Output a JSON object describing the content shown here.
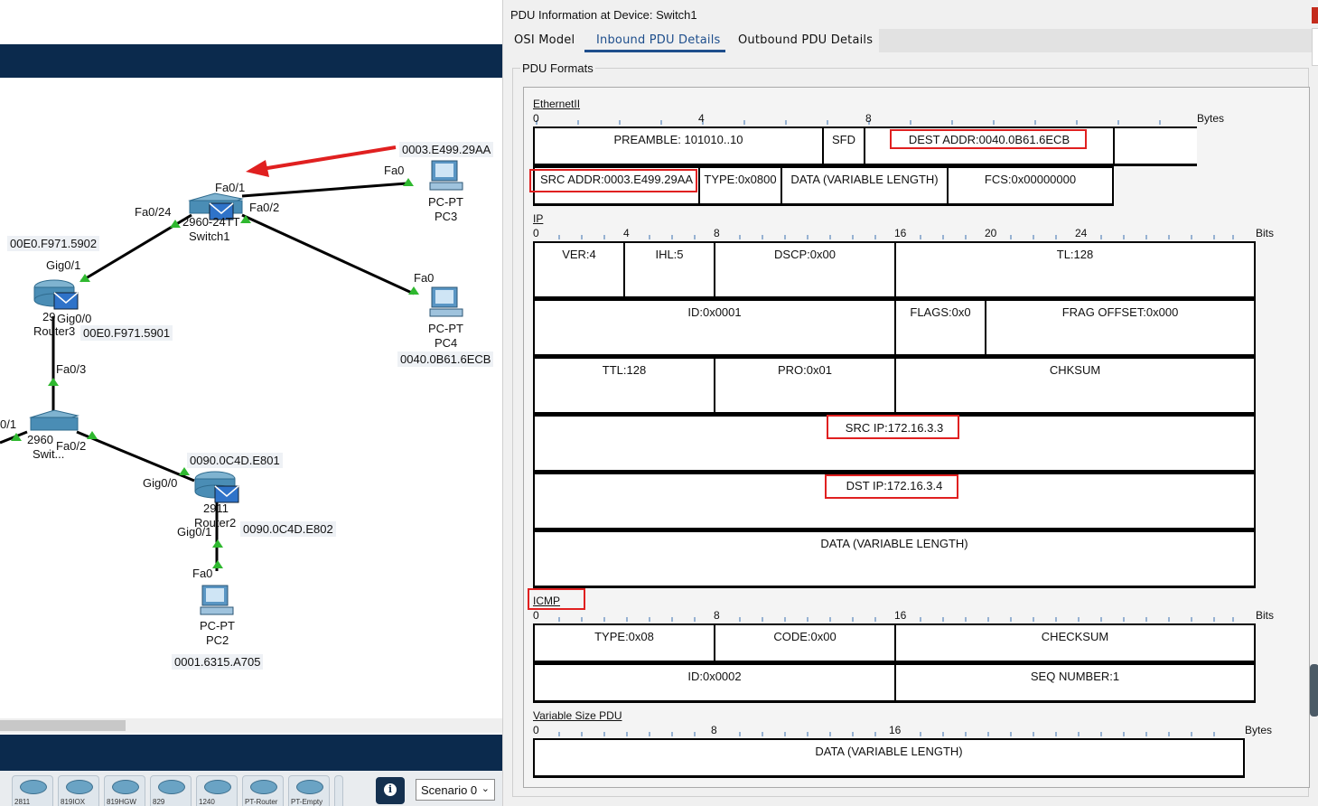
{
  "dialog": {
    "title": "PDU Information at Device: Switch1",
    "tabs": [
      "OSI Model",
      "Inbound PDU Details",
      "Outbound PDU Details"
    ],
    "active_tab": "Inbound PDU Details",
    "group_label": "PDU Formats"
  },
  "ethernet": {
    "name": "EthernetII",
    "unit": "Bytes",
    "ticks": [
      "0",
      "4",
      "8"
    ],
    "fields": {
      "preamble": "PREAMBLE: 101010..10",
      "sfd": "SFD",
      "dest": "DEST ADDR:0040.0B61.6ECB",
      "src": "SRC ADDR:0003.E499.29AA",
      "type": "TYPE:0x0800",
      "data": "DATA (VARIABLE LENGTH)",
      "fcs": "FCS:0x00000000"
    }
  },
  "ip": {
    "name": "IP",
    "unit": "Bits",
    "ticks": [
      "0",
      "4",
      "8",
      "16",
      "20",
      "24"
    ],
    "fields": {
      "ver": "VER:4",
      "ihl": "IHL:5",
      "dscp": "DSCP:0x00",
      "tl": "TL:128",
      "id": "ID:0x0001",
      "flags": "FLAGS:0x0",
      "frag": "FRAG OFFSET:0x000",
      "ttl": "TTL:128",
      "pro": "PRO:0x01",
      "chksum": "CHKSUM",
      "src": "SRC IP:172.16.3.3",
      "dst": "DST IP:172.16.3.4",
      "data": "DATA (VARIABLE LENGTH)"
    }
  },
  "icmp": {
    "name": "ICMP",
    "unit": "Bits",
    "ticks": [
      "0",
      "8",
      "16"
    ],
    "fields": {
      "type": "TYPE:0x08",
      "code": "CODE:0x00",
      "checksum": "CHECKSUM",
      "id": "ID:0x0002",
      "seq": "SEQ NUMBER:1"
    }
  },
  "variable": {
    "name": "Variable Size PDU",
    "unit": "Bytes",
    "ticks": [
      "0",
      "8",
      "16"
    ],
    "fields": {
      "data": "DATA (VARIABLE LENGTH)"
    }
  },
  "topology": {
    "macs": {
      "pc3": "0003.E499.29AA",
      "pc4": "0040.0B61.6ECB",
      "r_g01": "00E0.F971.5902",
      "r_g00": "00E0.F971.5901",
      "r2_g00": "0090.0C4D.E801",
      "r2_g01": "0090.0C4D.E802",
      "pc2": "0001.6315.A705"
    },
    "ports": {
      "fa0_pc3": "Fa0",
      "sw1_fa01": "Fa0/1",
      "sw1_fa02": "Fa0/2",
      "sw1_fa024": "Fa0/24",
      "fa0_pc4": "Fa0",
      "r_gig01": "Gig0/1",
      "r_gig00": "Gig0/0",
      "r_fa03": "Fa0/3",
      "sw_left": "0/1",
      "sw2_fa02": "Fa0/2",
      "r2_gig00": "Gig0/0",
      "r2_gig01": "Gig0/1",
      "pc2_fa0": "Fa0"
    },
    "devices": {
      "pc3_type": "PC-PT",
      "pc3_name": "PC3",
      "pc4_type": "PC-PT",
      "pc4_name": "PC4",
      "sw1_model": "2960-24TT",
      "sw1_name": "Switch1",
      "router_model": "29",
      "router_name": "Router3",
      "sw2_model": "2960",
      "sw2_name": "Swit...",
      "r2_model": "2911",
      "r2_name": "Router2",
      "pc2_type": "PC-PT",
      "pc2_name": "PC2"
    }
  },
  "tray": {
    "devices": [
      "2811",
      "819IOX",
      "819HGW",
      "829",
      "1240",
      "PT-Router",
      "PT-Empty",
      ""
    ]
  },
  "scenario": {
    "selected": "Scenario 0"
  },
  "colors": {
    "accent": "#1e4e8c",
    "highlight": "#e02020",
    "band": "#0b2a4d"
  }
}
